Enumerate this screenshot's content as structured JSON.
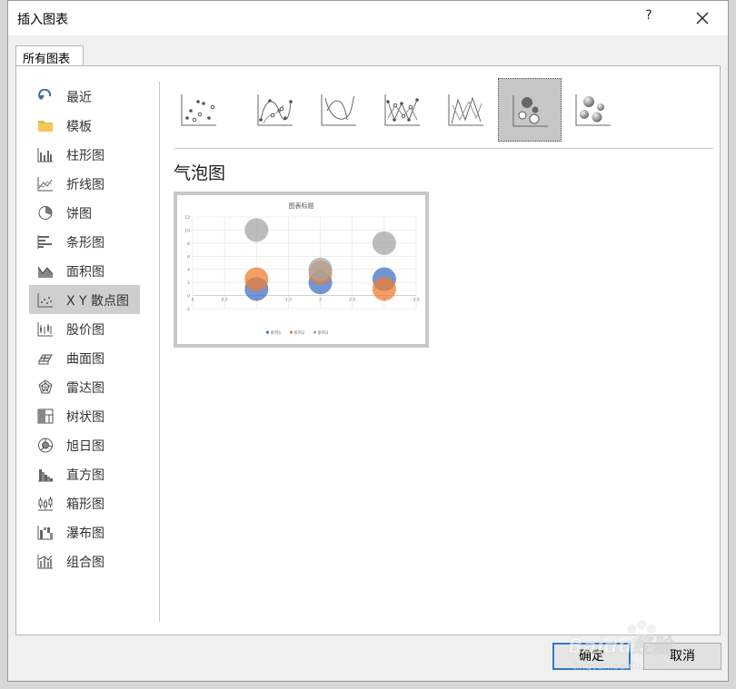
{
  "window": {
    "title": "插入图表",
    "help_label": "?"
  },
  "tabs": [
    {
      "label": "所有图表"
    }
  ],
  "sidebar": {
    "items": [
      {
        "label": "最近",
        "icon": "recent-icon"
      },
      {
        "label": "模板",
        "icon": "folder-icon"
      },
      {
        "label": "柱形图",
        "icon": "column-chart-icon"
      },
      {
        "label": "折线图",
        "icon": "line-chart-icon"
      },
      {
        "label": "饼图",
        "icon": "pie-chart-icon"
      },
      {
        "label": "条形图",
        "icon": "bar-chart-icon"
      },
      {
        "label": "面积图",
        "icon": "area-chart-icon"
      },
      {
        "label": "X Y 散点图",
        "icon": "scatter-chart-icon",
        "selected": true
      },
      {
        "label": "股价图",
        "icon": "stock-chart-icon"
      },
      {
        "label": "曲面图",
        "icon": "surface-chart-icon"
      },
      {
        "label": "雷达图",
        "icon": "radar-chart-icon"
      },
      {
        "label": "树状图",
        "icon": "treemap-chart-icon"
      },
      {
        "label": "旭日图",
        "icon": "sunburst-chart-icon"
      },
      {
        "label": "直方图",
        "icon": "histogram-chart-icon"
      },
      {
        "label": "箱形图",
        "icon": "box-chart-icon"
      },
      {
        "label": "瀑布图",
        "icon": "waterfall-chart-icon"
      },
      {
        "label": "组合图",
        "icon": "combo-chart-icon"
      }
    ]
  },
  "chart_types": [
    {
      "icon": "scatter-icon"
    },
    {
      "icon": "scatter-smooth-markers-icon"
    },
    {
      "icon": "scatter-smooth-lines-icon"
    },
    {
      "icon": "scatter-straight-markers-icon"
    },
    {
      "icon": "scatter-straight-lines-icon"
    },
    {
      "icon": "bubble-icon",
      "selected": true
    },
    {
      "icon": "bubble-3d-icon"
    }
  ],
  "subtype_title": "气泡图",
  "buttons": {
    "ok": "确定",
    "cancel": "取消"
  },
  "watermark": {
    "text": "Baidu经验",
    "sub": "jingyan.baidu.com"
  },
  "colors": {
    "series1": "#4472c4",
    "series2": "#ed7d31",
    "series3": "#a5a5a5",
    "selected_bg": "#c6c6c6",
    "ok_border": "#2b79d0"
  },
  "chart_data": {
    "type": "bubble",
    "title": "图表标题",
    "xlim": [
      0,
      3.5
    ],
    "ylim": [
      -2,
      12
    ],
    "x_ticks": [
      "0",
      "0.5",
      "1",
      "1.5",
      "2",
      "2.5",
      "3",
      "3.5"
    ],
    "y_ticks": [
      "-2",
      "0",
      "2",
      "4",
      "6",
      "8",
      "10",
      "12"
    ],
    "legend_position": "bottom",
    "series": [
      {
        "name": "系列1",
        "color": "#4472c4",
        "points": [
          {
            "x": 1,
            "y": 1,
            "size": 10
          },
          {
            "x": 2,
            "y": 2,
            "size": 10
          },
          {
            "x": 3,
            "y": 2.5,
            "size": 10
          }
        ]
      },
      {
        "name": "系列2",
        "color": "#ed7d31",
        "points": [
          {
            "x": 1,
            "y": 2.5,
            "size": 10
          },
          {
            "x": 2,
            "y": 3.5,
            "size": 10
          },
          {
            "x": 3,
            "y": 1,
            "size": 10
          }
        ]
      },
      {
        "name": "系列3",
        "color": "#a5a5a5",
        "points": [
          {
            "x": 1,
            "y": 10,
            "size": 10
          },
          {
            "x": 2,
            "y": 4,
            "size": 10
          },
          {
            "x": 3,
            "y": 8,
            "size": 10
          }
        ]
      }
    ]
  }
}
